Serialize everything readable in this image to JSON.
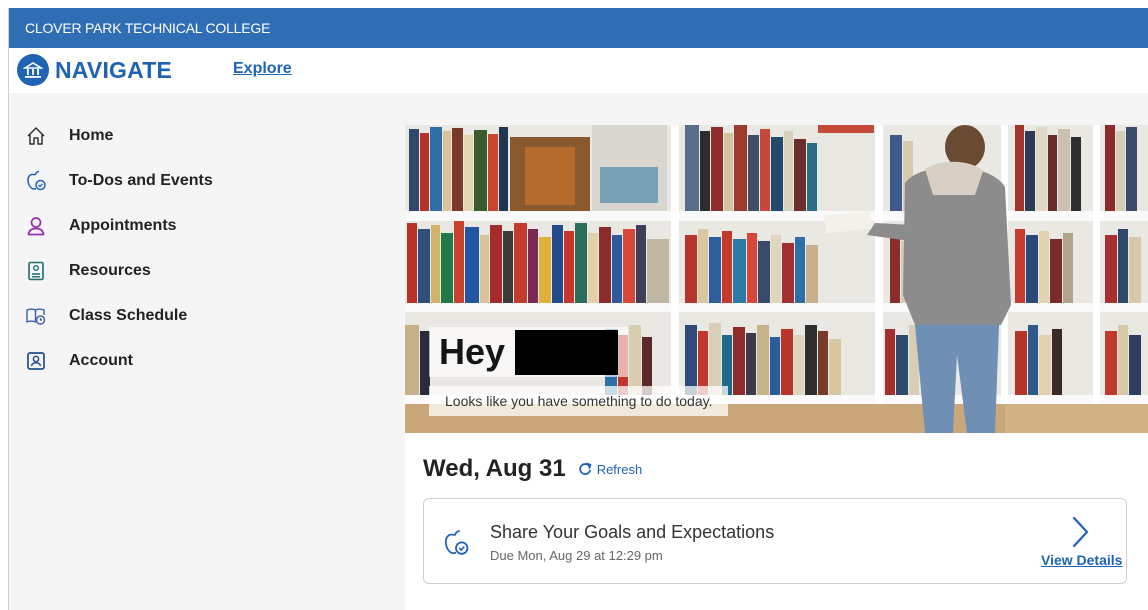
{
  "topbar": {
    "institution": "CLOVER PARK TECHNICAL COLLEGE"
  },
  "navbar": {
    "logo_text": "NAVIGATE",
    "explore_label": "Explore"
  },
  "sidebar": {
    "items": [
      {
        "label": "Home",
        "icon": "home-icon"
      },
      {
        "label": "To-Dos and Events",
        "icon": "apple-check-icon"
      },
      {
        "label": "Appointments",
        "icon": "person-icon"
      },
      {
        "label": "Resources",
        "icon": "resource-book-icon"
      },
      {
        "label": "Class Schedule",
        "icon": "class-schedule-icon"
      },
      {
        "label": "Account",
        "icon": "account-card-icon"
      }
    ]
  },
  "hero": {
    "greeting": "Hey",
    "subtitle": "Looks like you have something to do today."
  },
  "schedule": {
    "date": "Wed, Aug 31",
    "refresh_label": "Refresh"
  },
  "todo": {
    "title": "Share Your Goals and Expectations",
    "due": "Due Mon, Aug 29 at 12:29 pm",
    "view_details_label": "View Details"
  },
  "colors": {
    "brand_blue": "#1f63b4",
    "topbar_blue": "#2f6db5",
    "appointments_purple": "#9b2bb6"
  }
}
